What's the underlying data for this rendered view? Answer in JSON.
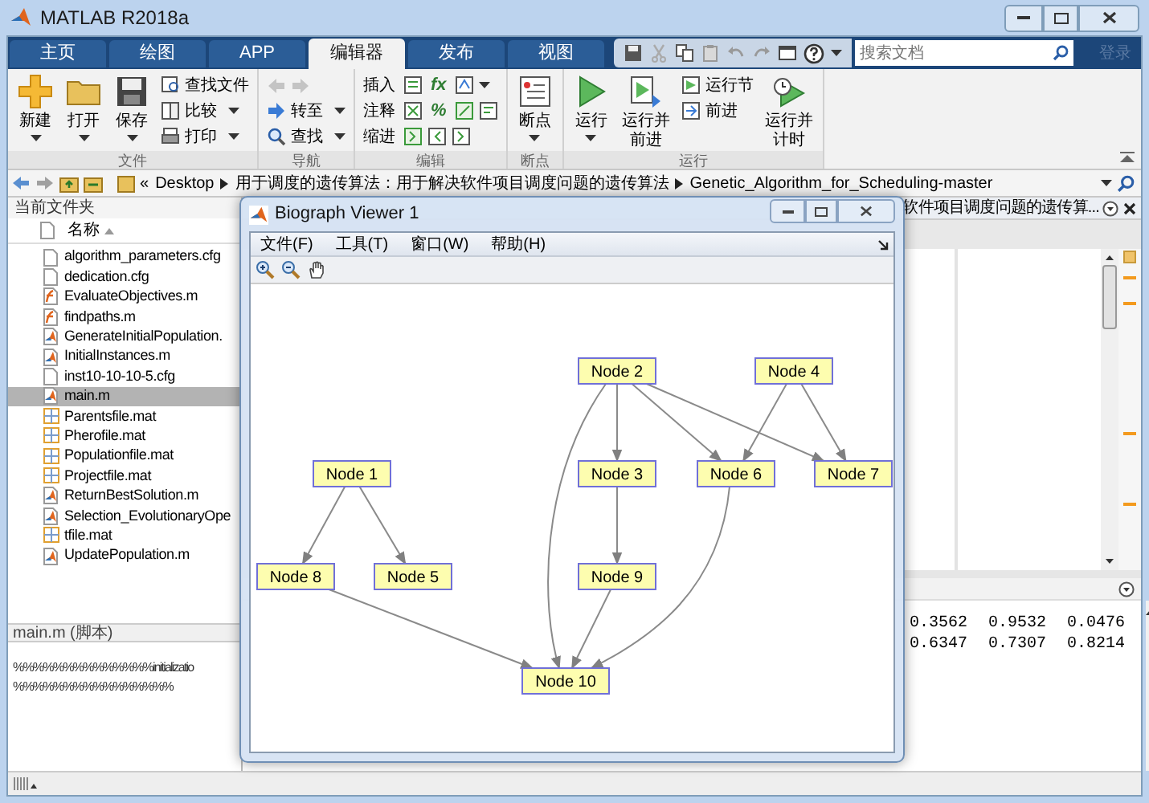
{
  "window": {
    "title": "MATLAB R2018a"
  },
  "tabs": [
    {
      "label": "主页",
      "selected": false
    },
    {
      "label": "绘图",
      "selected": false
    },
    {
      "label": "APP",
      "selected": false
    },
    {
      "label": "编辑器",
      "selected": true
    },
    {
      "label": "发布",
      "selected": false
    },
    {
      "label": "视图",
      "selected": false
    }
  ],
  "search": {
    "placeholder": "搜索文档"
  },
  "login": {
    "label": "登录",
    "disabled": true
  },
  "ribbon": {
    "groups": [
      {
        "label": "文件",
        "items": [
          {
            "kind": "large",
            "label": "新建",
            "caret": true
          },
          {
            "kind": "large",
            "label": "打开",
            "caret": true
          },
          {
            "kind": "large",
            "label": "保存",
            "caret": true
          },
          {
            "kind": "stack",
            "rows": [
              {
                "label": "查找文件",
                "caret": false
              },
              {
                "label": "比较",
                "caret": true
              },
              {
                "label": "打印",
                "caret": true
              }
            ]
          }
        ]
      },
      {
        "label": "导航",
        "items": [
          {
            "kind": "stack",
            "rows": [
              {
                "disabled": true
              },
              {
                "label": "转至",
                "caret": true
              },
              {
                "label": "查找",
                "caret": true
              }
            ]
          }
        ]
      },
      {
        "label": "编辑",
        "items": [
          {
            "kind": "stack",
            "rows": [
              {
                "label": "插入",
                "glyphs": [
                  "fx"
                ],
                "caret": true
              },
              {
                "label": "注释",
                "glyphs": [
                  "%"
                ]
              },
              {
                "label": "缩进"
              }
            ]
          }
        ]
      },
      {
        "label": "断点",
        "items": [
          {
            "kind": "large",
            "label": "断点",
            "caret": true
          }
        ]
      },
      {
        "label": "运行",
        "items": [
          {
            "kind": "large",
            "label": "运行",
            "caret": true
          },
          {
            "kind": "large",
            "label": "运行并前进",
            "caret": false
          },
          {
            "kind": "stack",
            "rows": [
              {
                "label": "运行节",
                "caret": false
              },
              {
                "label": "前进",
                "caret": false
              }
            ]
          },
          {
            "kind": "large",
            "label": "运行并计时",
            "caret": false
          }
        ]
      }
    ]
  },
  "address_bar": {
    "overflow_marker": "«",
    "segments": [
      "Desktop",
      "用于调度的遗传算法：用于解决软件项目调度问题的遗传算法",
      "Genetic_Algorithm_for_Scheduling-master"
    ]
  },
  "current_folder": {
    "title": "当前文件夹",
    "column": "名称",
    "files": [
      {
        "name": "algorithm_parameters.cfg",
        "kind": "text",
        "selected": false
      },
      {
        "name": "dedication.cfg",
        "kind": "text",
        "selected": false
      },
      {
        "name": "EvaluateObjectives.m",
        "kind": "function",
        "selected": false
      },
      {
        "name": "findpaths.m",
        "kind": "function",
        "selected": false
      },
      {
        "name": "GenerateInitialPopulation.",
        "kind": "script",
        "selected": false
      },
      {
        "name": "InitialInstances.m",
        "kind": "script",
        "selected": false
      },
      {
        "name": "inst10-10-10-5.cfg",
        "kind": "text",
        "selected": false
      },
      {
        "name": "main.m",
        "kind": "script",
        "selected": true
      },
      {
        "name": "Parentsfile.mat",
        "kind": "data",
        "selected": false
      },
      {
        "name": "Pherofile.mat",
        "kind": "data",
        "selected": false
      },
      {
        "name": "Populationfile.mat",
        "kind": "data",
        "selected": false
      },
      {
        "name": "Projectfile.mat",
        "kind": "data",
        "selected": false
      },
      {
        "name": "ReturnBestSolution.m",
        "kind": "script",
        "selected": false
      },
      {
        "name": "Selection_EvolutionaryOpe",
        "kind": "script",
        "selected": false
      },
      {
        "name": "tfile.mat",
        "kind": "data",
        "selected": false
      },
      {
        "name": "UpdatePopulation.m",
        "kind": "script",
        "selected": false
      }
    ]
  },
  "details": {
    "title": "main.m",
    "type": "(脚本)",
    "lines": [
      "%%%%%%%%%%%%%%initializatio",
      "%%%%%%%%%%%%%%%%"
    ]
  },
  "editor": {
    "tab_title": "软件项目调度问题的遗传算..."
  },
  "command_window": {
    "rows": [
      [
        "0.3562",
        "0.9532",
        "0.0476"
      ],
      [
        "0.6347",
        "0.7307",
        "0.8214"
      ]
    ]
  },
  "viewer": {
    "title": "Biograph Viewer 1",
    "menu": [
      "文件(F)",
      "工具(T)",
      "窗口(W)",
      "帮助(H)"
    ],
    "graph": {
      "nodes": [
        {
          "label": "Node 1"
        },
        {
          "label": "Node 2"
        },
        {
          "label": "Node 3"
        },
        {
          "label": "Node 4"
        },
        {
          "label": "Node 5"
        },
        {
          "label": "Node 6"
        },
        {
          "label": "Node 7"
        },
        {
          "label": "Node 8"
        },
        {
          "label": "Node 9"
        },
        {
          "label": "Node 10"
        }
      ]
    }
  }
}
